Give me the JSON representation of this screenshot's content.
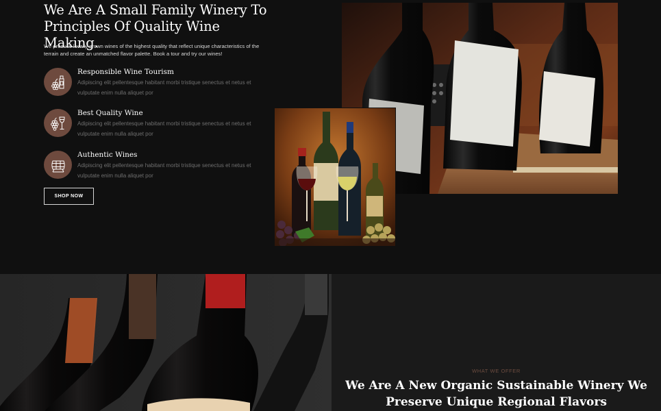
{
  "hero": {
    "title": "We Are A Small Family Winery To Principles Of Quality Wine Making.",
    "intro": "We produce locally grown wines of the highest quality that reflect unique characteristics of the terrain and create an unmatched flavor palette. Book a tour and try our wines!",
    "features": [
      {
        "icon": "wine-tourism-icon",
        "title": "Responsible Wine Tourism",
        "text": "Adipiscing elit pellentesque habitant morbi tristique senectus et netus et vulputate enim nulla aliquet por"
      },
      {
        "icon": "wine-glass-grapes-icon",
        "title": "Best Quality Wine",
        "text": "Adipiscing elit pellentesque habitant morbi tristique senectus et netus et vulputate enim nulla aliquet por"
      },
      {
        "icon": "wine-barrel-icon",
        "title": "Authentic Wines",
        "text": "Adipiscing elit pellentesque habitant morbi tristique senectus et netus et vulputate enim nulla aliquet por"
      }
    ],
    "button_label": "SHOP NOW"
  },
  "offer": {
    "eyebrow": "WHAT WE OFFER",
    "headline": "We Are A New Organic Sustainable Winery We Preserve Unique Regional Flavors"
  },
  "colors": {
    "background": "#101010",
    "accent_brown": "#6e4a3e",
    "panel": "#1a1a1a"
  }
}
